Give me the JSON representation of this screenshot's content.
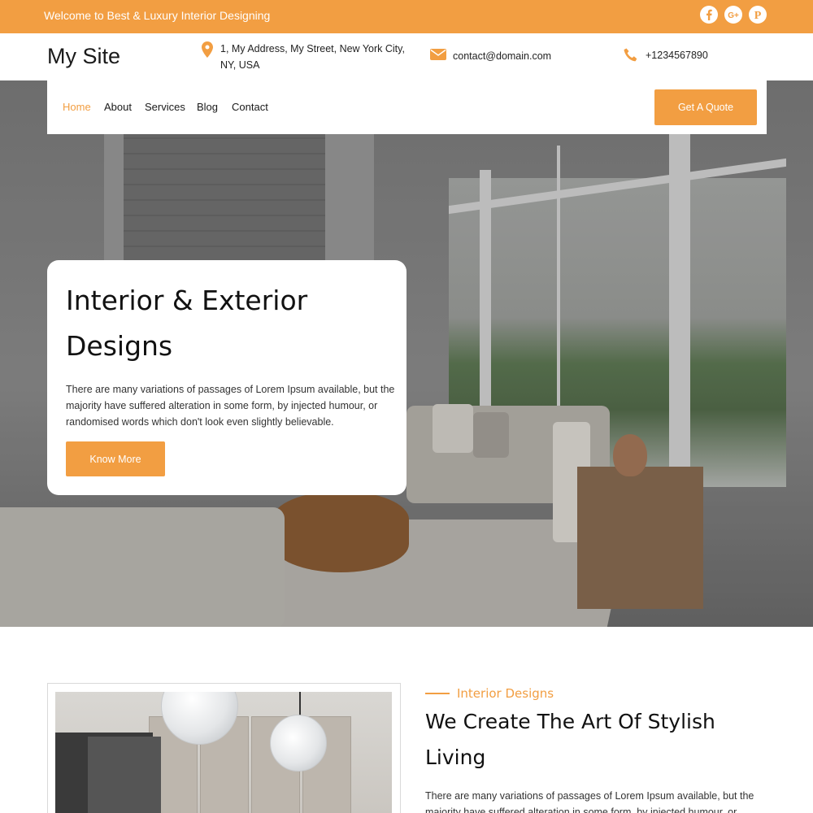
{
  "topbar": {
    "welcome": "Welcome to Best & Luxury Interior Designing",
    "social": [
      "facebook-icon",
      "google-plus-icon",
      "pinterest-icon"
    ]
  },
  "header": {
    "site_title": "My Site",
    "address": "1, My Address, My Street, New York City, NY, USA",
    "email": "contact@domain.com",
    "phone": "+1234567890"
  },
  "nav": {
    "items": [
      {
        "label": "Home",
        "active": true
      },
      {
        "label": "About"
      },
      {
        "label": "Services"
      },
      {
        "label": "Blog"
      },
      {
        "label": "Contact"
      }
    ],
    "quote_label": "Get A Quote"
  },
  "hero": {
    "title": "Interior & Exterior Designs",
    "text": "There are many variations of passages of Lorem Ipsum available, but the majority have suffered alteration in some form, by injected humour, or randomised words which don't look even slightly believable.",
    "button_label": "Know More"
  },
  "about": {
    "eyebrow": "Interior Designs",
    "title": "We Create The Art Of Stylish Living",
    "text": "There are many variations of passages of Lorem Ipsum available, but the majority have suffered alteration in some form, by injected humour, or"
  },
  "colors": {
    "accent": "#f29e42",
    "text": "#1a1a1a"
  }
}
